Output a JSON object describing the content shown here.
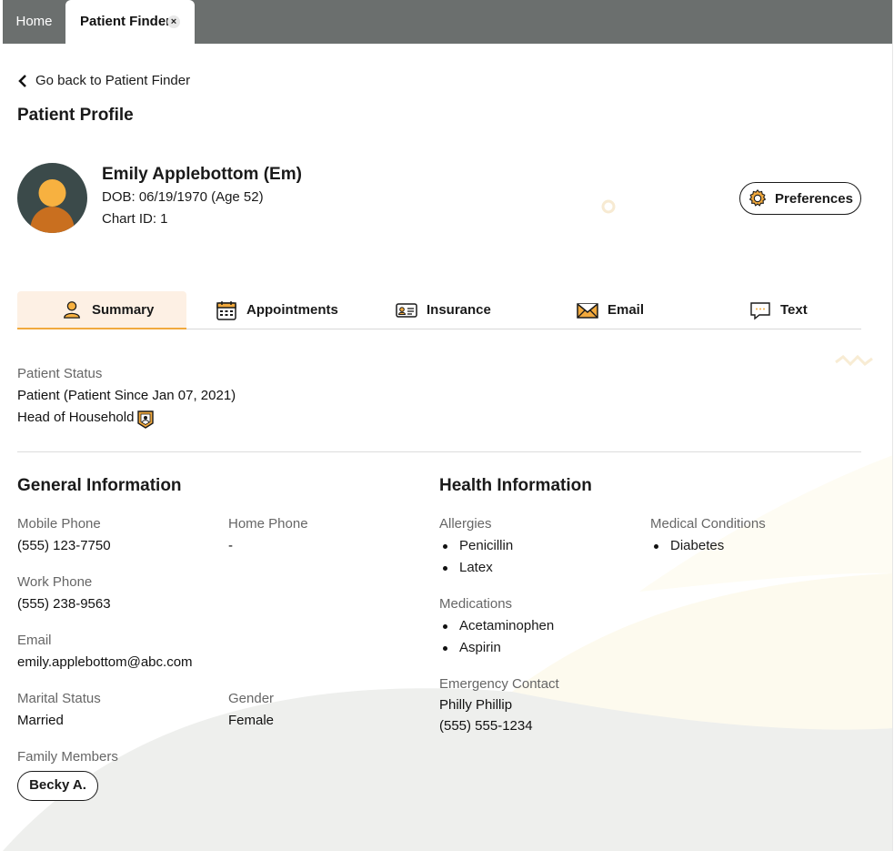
{
  "top_tabs": {
    "home": "Home",
    "active": "Patient Finder",
    "close_symbol": "×"
  },
  "back_link": "Go back to Patient Finder",
  "page_title": "Patient Profile",
  "patient": {
    "name": "Emily Applebottom (Em)",
    "dob": "DOB: 06/19/1970 (Age 52)",
    "chart_id": "Chart ID: 1"
  },
  "preferences_label": "Preferences",
  "profile_tabs": [
    {
      "label": "Summary",
      "icon": "person-icon"
    },
    {
      "label": "Appointments",
      "icon": "calendar-icon"
    },
    {
      "label": "Insurance",
      "icon": "id-card-icon"
    },
    {
      "label": "Email",
      "icon": "envelope-icon"
    },
    {
      "label": "Text",
      "icon": "chat-bubble-icon"
    }
  ],
  "status": {
    "label": "Patient Status",
    "value": "Patient (Patient Since Jan 07, 2021)",
    "household": "Head of Household"
  },
  "general": {
    "title": "General Information",
    "mobile_label": "Mobile Phone",
    "mobile_value": "(555) 123-7750",
    "home_label": "Home Phone",
    "home_value": "-",
    "work_label": "Work Phone",
    "work_value": "(555) 238-9563",
    "email_label": "Email",
    "email_value": "emily.applebottom@abc.com",
    "marital_label": "Marital Status",
    "marital_value": "Married",
    "gender_label": "Gender",
    "gender_value": "Female",
    "family_label": "Family Members",
    "family_members": [
      "Becky A."
    ]
  },
  "health": {
    "title": "Health Information",
    "allergies_label": "Allergies",
    "allergies": [
      "Penicillin",
      "Latex"
    ],
    "conditions_label": "Medical Conditions",
    "conditions": [
      "Diabetes"
    ],
    "medications_label": "Medications",
    "medications": [
      "Acetaminophen",
      "Aspirin"
    ],
    "emergency_label": "Emergency Contact",
    "emergency_name": "Philly Phillip",
    "emergency_phone": "(555) 555-1234"
  },
  "colors": {
    "accent": "#f1a93d",
    "topbar": "#6b6f6e",
    "avatar_bg": "#3b4a4a",
    "tab_active_bg": "#fdf0e4"
  }
}
